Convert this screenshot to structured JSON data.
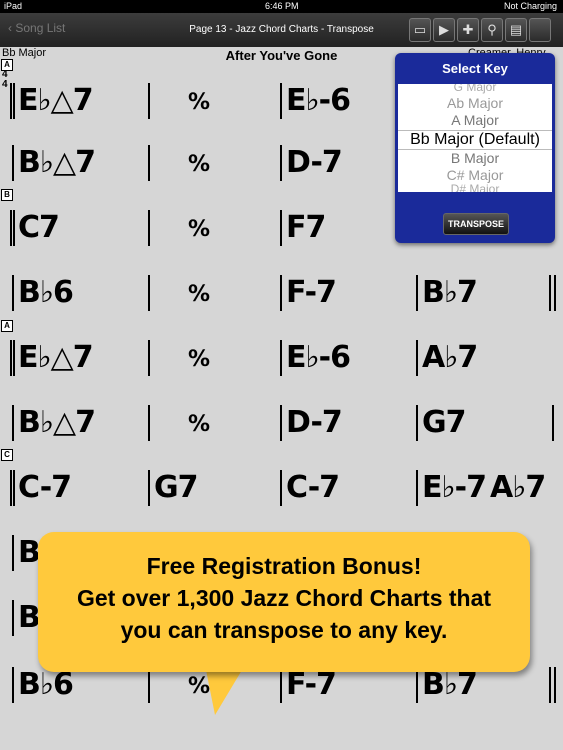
{
  "status": {
    "device": "iPad",
    "time": "6:46 PM",
    "battery": "Not Charging"
  },
  "nav": {
    "back": "Song List",
    "title": "Page 13 - Jazz Chord Charts - Transpose"
  },
  "toolbar": {
    "icons": [
      "window-icon",
      "play-icon",
      "add-icon",
      "wrench-icon",
      "comment-icon",
      "more-icon"
    ]
  },
  "chart": {
    "key": "Bb Major",
    "title": "After You've Gone",
    "composer": "Creamer, Henry",
    "marks": [
      "A",
      "B",
      "A",
      "C"
    ],
    "timesig_top": "4",
    "timesig_bottom": "4",
    "rows": [
      [
        "E♭△7",
        "%",
        "E♭-6",
        ""
      ],
      [
        "B♭△7",
        "%",
        "D-7",
        ""
      ],
      [
        "C7",
        "%",
        "F7",
        ""
      ],
      [
        "B♭6",
        "%",
        "F-7",
        "B♭7"
      ],
      [
        "E♭△7",
        "%",
        "E♭-6",
        "A♭7"
      ],
      [
        "B♭△7",
        "%",
        "D-7",
        "G7"
      ],
      [
        "C-7",
        "G7",
        "C-7",
        "E♭-7",
        "A♭7"
      ],
      [
        "B♭",
        "",
        "",
        "",
        ""
      ],
      [
        "B♭",
        "",
        "",
        "",
        ""
      ],
      [
        "B♭6",
        "%",
        "F-7",
        "B♭7"
      ]
    ]
  },
  "popover": {
    "title": "Select Key",
    "options": [
      "G Major",
      "Ab Major",
      "A Major",
      "Bb Major (Default)",
      "B Major",
      "C# Major",
      "D# Major"
    ],
    "button": "TRANSPOSE"
  },
  "bubble": {
    "line1": "Free Registration Bonus!",
    "line2": "Get over 1,300 Jazz Chord Charts that",
    "line3": "you can transpose to any key."
  }
}
